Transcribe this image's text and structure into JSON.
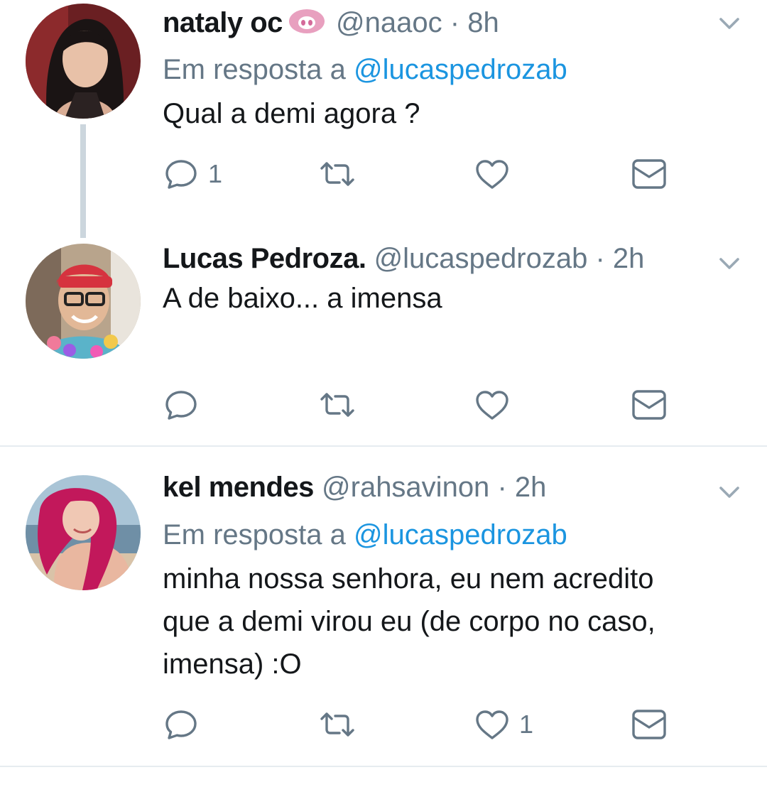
{
  "tweets": [
    {
      "name": "nataly oc",
      "handle": "@naaoc",
      "separator": "·",
      "time": "8h",
      "reply_label": "Em resposta a",
      "reply_mention": "@lucaspedrozab",
      "text": "Qual a demi agora ?",
      "reply_count": "1",
      "retweet_count": "",
      "like_count": ""
    },
    {
      "name": "Lucas Pedroza.",
      "handle": "@lucaspedrozab",
      "separator": "·",
      "time": "2h",
      "text": "A de baixo... a imensa",
      "reply_count": "",
      "retweet_count": "",
      "like_count": ""
    },
    {
      "name": "kel mendes",
      "handle": "@rahsavinon",
      "separator": "·",
      "time": "2h",
      "reply_label": "Em resposta a",
      "reply_mention": "@lucaspedrozab",
      "text_lines": [
        "minha nossa senhora, eu nem acredito",
        "que a demi virou eu (de corpo no caso,",
        "imensa) :O"
      ],
      "reply_count": "",
      "retweet_count": "",
      "like_count": "1"
    }
  ],
  "colors": {
    "primary_text": "#14171a",
    "secondary_text": "#657786",
    "link": "#1b95e0",
    "thread_line": "#ccd6dd",
    "badge_pink": "#e8a0bf"
  },
  "icons": [
    "reply-icon",
    "retweet-icon",
    "like-icon",
    "direct-message-icon",
    "chevron-down-icon",
    "pig-emoji-icon"
  ]
}
